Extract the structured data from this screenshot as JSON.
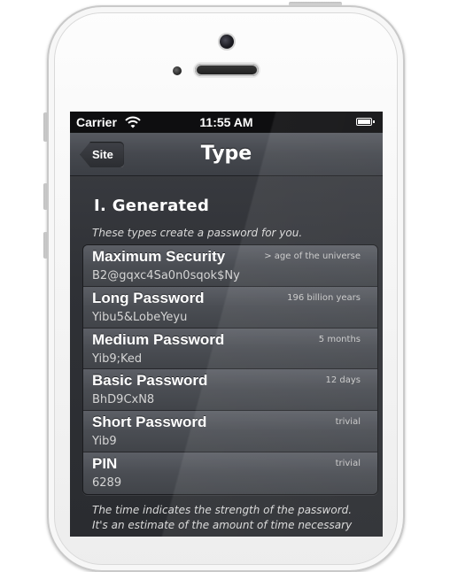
{
  "status_bar": {
    "carrier": "Carrier",
    "time": "11:55 AM",
    "wifi_icon": "wifi-icon",
    "battery_icon": "battery-icon"
  },
  "nav": {
    "back_label": "Site",
    "title": "Type"
  },
  "section": {
    "title": "I. Generated",
    "note": "These types create a password for you."
  },
  "types": [
    {
      "name": "Maximum Security",
      "example": "B2@gqxc4Sa0n0sqok$Ny",
      "strength": "> age of the universe"
    },
    {
      "name": "Long Password",
      "example": "Yibu5&LobeYeyu",
      "strength": "196 billion years"
    },
    {
      "name": "Medium Password",
      "example": "Yib9;Ked",
      "strength": "5 months"
    },
    {
      "name": "Basic Password",
      "example": "BhD9CxN8",
      "strength": "12 days"
    },
    {
      "name": "Short Password",
      "example": "Yib9",
      "strength": "trivial"
    },
    {
      "name": "PIN",
      "example": "6289",
      "strength": "trivial"
    }
  ],
  "footer": {
    "line1": "The time indicates the strength of the password.",
    "line2": "It's an estimate of the amount of time necessary"
  }
}
